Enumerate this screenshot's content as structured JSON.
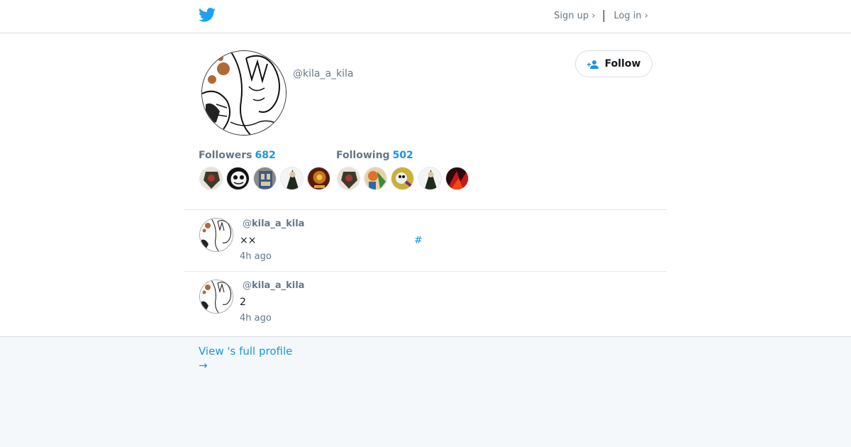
{
  "header": {
    "logo_icon": "twitter-bird-icon",
    "signup_label": "Sign up ›",
    "login_label": "Log in ›",
    "brand_color": "#1da1f2"
  },
  "profile": {
    "display_name": "",
    "handle": "@kila_a_kila",
    "follow_label": "Follow",
    "followers_label": "Followers",
    "followers_count": "682",
    "following_label": "Following",
    "following_count": "502"
  },
  "tweets": [
    {
      "at": "@",
      "user": "kila_a_kila",
      "text": "××",
      "hashtag": "#",
      "time": "4h ago"
    },
    {
      "at": "@",
      "user": "kila_a_kila",
      "text": "2",
      "hashtag": "",
      "time": "4h ago"
    }
  ],
  "footer": {
    "view_full_profile": "View 's full profile",
    "arrow": "→"
  }
}
